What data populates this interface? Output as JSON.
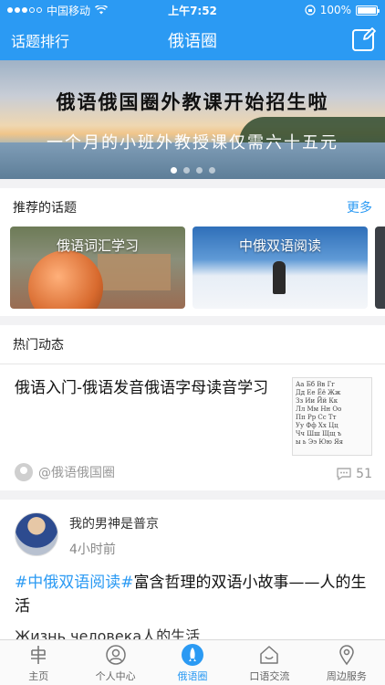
{
  "status_bar": {
    "carrier": "中国移动",
    "time": "上午7:52",
    "battery": "100%"
  },
  "nav": {
    "left": "话题排行",
    "title": "俄语圈"
  },
  "banner": {
    "line1": "俄语俄国圈外教课开始招生啦",
    "line2": "一个月的小班外教授课仅需六十五元",
    "pages": 4,
    "active_page": 1
  },
  "recommended": {
    "heading": "推荐的话题",
    "more": "更多",
    "topics": [
      {
        "label": "俄语词汇学习"
      },
      {
        "label": "中俄双语阅读"
      }
    ]
  },
  "hot": {
    "heading": "热门动态",
    "post1": {
      "title": "俄语入门-俄语发音俄语字母读音学习",
      "source": "@俄语俄国圈",
      "comments": "51",
      "thumb_lines": [
        "Аа Бб Вв Гг",
        "Дд Ее Ёё Жж",
        "Зз Ии Йй Кк",
        "Лл Мм Нн Оо",
        "Пп Рр Сс Тт",
        "Уу Фф Хх Цц",
        "Чч Шш Щщ ъ",
        "ы ь Ээ Юю Яя"
      ]
    },
    "post2": {
      "author": "我的男神是普京",
      "time": "4小时前",
      "tag": "#中俄双语阅读#",
      "text": "富含哲理的双语小故事——人的生活",
      "excerpt": "Жизнь человека人的生活"
    }
  },
  "tabs": [
    {
      "label": "主页",
      "icon": "home-icon",
      "active": false
    },
    {
      "label": "个人中心",
      "icon": "person-icon",
      "active": false
    },
    {
      "label": "俄语圈",
      "icon": "rocket-icon",
      "active": true
    },
    {
      "label": "口语交流",
      "icon": "house-chat-icon",
      "active": false
    },
    {
      "label": "周边服务",
      "icon": "location-pin-icon",
      "active": false
    }
  ],
  "colors": {
    "brand": "#2b9af3",
    "background": "#f2f2f4"
  }
}
